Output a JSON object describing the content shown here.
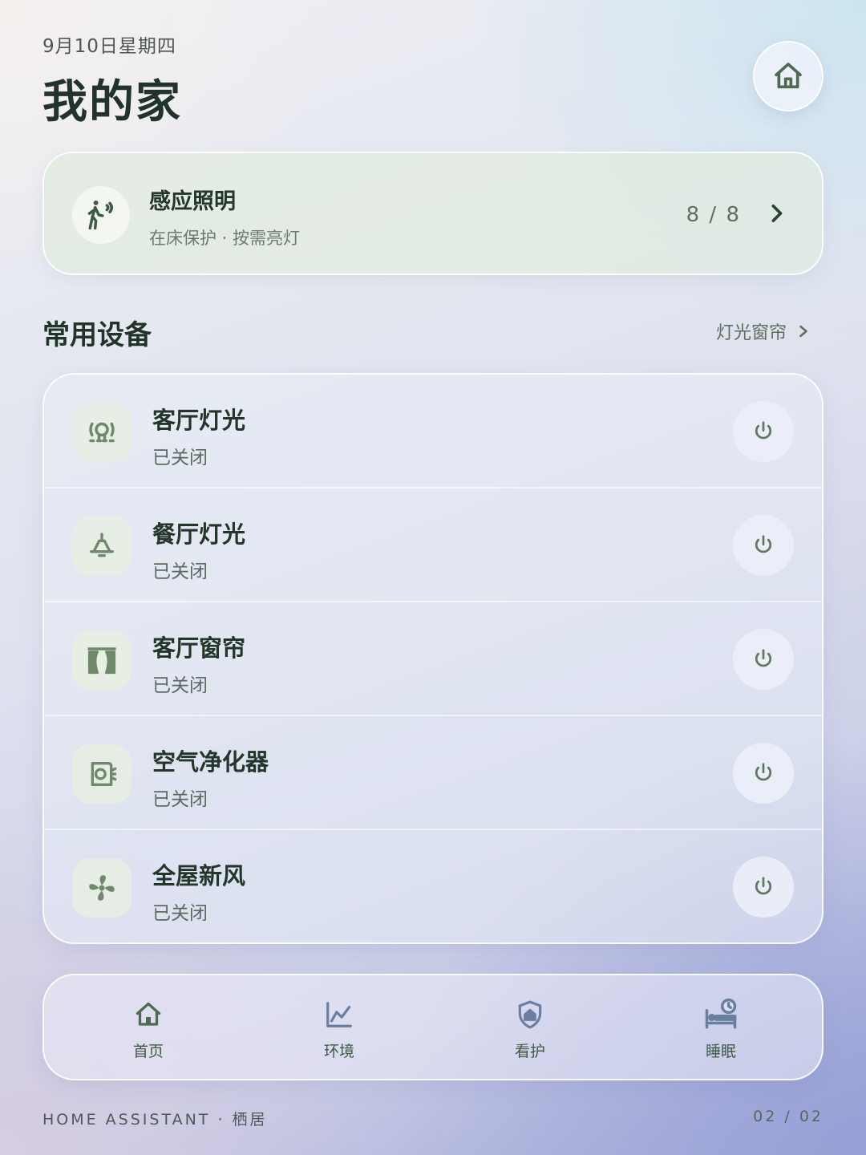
{
  "header": {
    "date": "9月10日星期四",
    "title": "我的家",
    "home_button_icon": "home-icon"
  },
  "sensor_card": {
    "icon": "motion-sensor-icon",
    "title": "感应照明",
    "subtitle": "在床保护 · 按需亮灯",
    "count": "8 / 8"
  },
  "section": {
    "title": "常用设备",
    "link_label": "灯光窗帘"
  },
  "devices": [
    {
      "name": "客厅灯光",
      "status": "已关闭",
      "icon": "ceiling-light-icon"
    },
    {
      "name": "餐厅灯光",
      "status": "已关闭",
      "icon": "pendant-lamp-icon"
    },
    {
      "name": "客厅窗帘",
      "status": "已关闭",
      "icon": "curtain-icon"
    },
    {
      "name": "空气净化器",
      "status": "已关闭",
      "icon": "air-purifier-icon"
    },
    {
      "name": "全屋新风",
      "status": "已关闭",
      "icon": "fan-icon"
    }
  ],
  "nav": [
    {
      "label": "首页",
      "icon": "home-icon"
    },
    {
      "label": "环境",
      "icon": "chart-line-icon"
    },
    {
      "label": "看护",
      "icon": "shield-home-icon"
    },
    {
      "label": "睡眠",
      "icon": "bed-clock-icon"
    }
  ],
  "footer": {
    "brand": "HOME ASSISTANT · 栖居",
    "page": "02 / 02"
  },
  "colors": {
    "accent": "#5f7a5e",
    "text_dark": "#24352a",
    "text_muted": "#5d6a60"
  }
}
